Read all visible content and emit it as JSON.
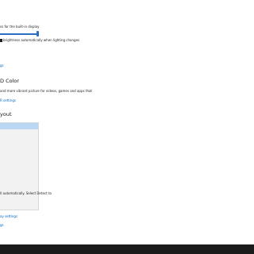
{
  "brightness": {
    "slider_label": "ss for the built-in display",
    "level_percent": 93,
    "auto_label": "brightness automatically when lighting changes",
    "link": "gs"
  },
  "hdr": {
    "heading": "D Color",
    "description": "and more vibrant picture for videos, games and apps that",
    "link": "R settings"
  },
  "layout": {
    "heading": "yout",
    "dropdown_options": [
      "",
      "",
      "",
      "",
      "",
      "",
      "",
      "",
      "",
      "",
      "",
      "",
      ""
    ],
    "note": "ll automatically. Select Detect to",
    "link": "ay settings",
    "link2": "gs"
  },
  "colors": {
    "accent": "#0067c0",
    "taskbar": "#1b1b1b",
    "selection": "#b9d7f3"
  }
}
